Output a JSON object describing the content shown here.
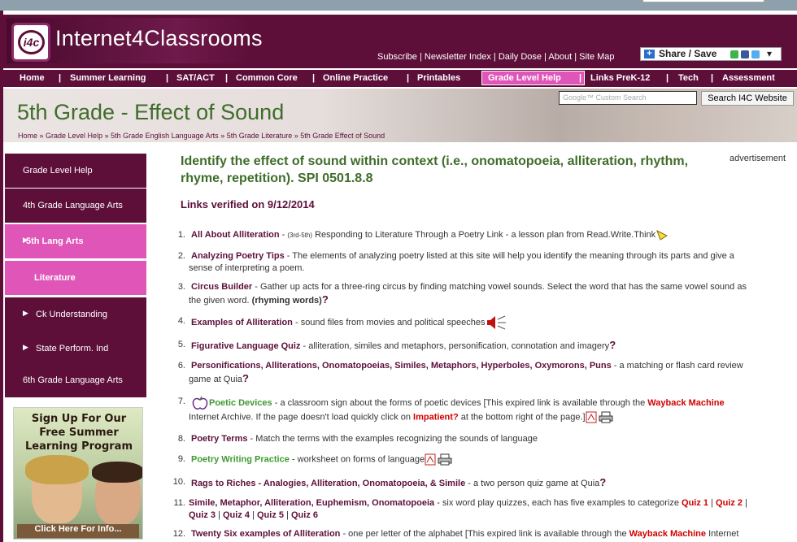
{
  "site": {
    "logo_mark": "i4c",
    "logo_text": "Internet4Classrooms"
  },
  "toplinks": [
    "Subscribe",
    "Newsletter Index",
    "Daily Dose",
    "About",
    "Site Map"
  ],
  "share_label": "Share / Save",
  "nav": {
    "items": [
      "Home",
      "Summer Learning",
      "SAT/ACT",
      "Common Core",
      "Online Practice",
      "Printables",
      "Grade Level Help",
      "Links PreK-12",
      "Tech",
      "Assessment"
    ],
    "active": "Grade Level Help"
  },
  "banner": {
    "title_grade": "5th Grade",
    "title_sep": " - ",
    "title_topic": "Effect of Sound",
    "search_placeholder": "Google™ Custom Search",
    "search_button": "Search I4C Website",
    "breadcrumb": [
      "Home",
      "Grade Level Help",
      "5th Grade English Language Arts",
      "5th Grade Literature",
      "5th Grade Effect of Sound"
    ]
  },
  "sidebar": {
    "items": [
      {
        "label": "Grade Level Help",
        "style": "dark"
      },
      {
        "label": "4th Grade Language Arts",
        "style": "dark"
      },
      {
        "label": "5th Lang Arts",
        "style": "pink"
      },
      {
        "label": "Literature",
        "style": "pink"
      },
      {
        "label": "Ck Understanding",
        "style": "dark"
      },
      {
        "label": "State Perform. Ind",
        "style": "dark"
      },
      {
        "label": "6th Grade Language Arts",
        "style": "dark"
      }
    ],
    "promo": {
      "line1": "Sign Up For Our",
      "line2": "Free Summer",
      "line3": "Learning Program",
      "cta": "Click Here For Info..."
    }
  },
  "main": {
    "heading": "Identify the effect of sound within context (i.e., onomatopoeia, alliteration, rhythm, rhyme, repetition). SPI 0501.8.8",
    "advertisement": "advertisement",
    "verified": "Links verified on 9/12/2014",
    "items": [
      {
        "n": "1.",
        "link": "All About Alliteration",
        "pre": "(3rd-5th)",
        "desc": "Responding to Literature Through a Poetry Link - a lesson plan from Read.Write.Think"
      },
      {
        "n": "2.",
        "link": "Analyzing Poetry Tips",
        "desc": "The elements of analyzing poetry listed at this site will help you identify the meaning through its parts and give a",
        "desc2": "sense of interpreting a poem."
      },
      {
        "n": "3.",
        "link": "Circus Builder",
        "desc": "Gather up acts for a three-ring circus by finding matching vowel sounds. Select the word that has the same vowel sound as",
        "desc2": "the given word.",
        "desc2b": "(rhyming words)"
      },
      {
        "n": "4.",
        "link": "Examples of Alliteration",
        "desc": "sound files from movies and political speeches"
      },
      {
        "n": "5.",
        "link": "Figurative Language Quiz",
        "desc": "alliteration, similes and metaphors, personification, connotation and imagery"
      },
      {
        "n": "6.",
        "link": "Personifications, Alliterations, Onomatopoeias, Similes, Metaphors, Hyperboles, Oxymorons, Puns",
        "desc": "a matching or flash card review",
        "desc2": "game at Quia"
      },
      {
        "n": "7.",
        "link": "Poetic Devices",
        "desc": "a classroom sign about the forms of poetic devices [This expired link is available through the",
        "red1": "Wayback Machine",
        "desc2": "Internet Archive. If the page doesn't load quickly click on",
        "red2": "Impatient?",
        "desc2b": "at the bottom right of the page.]"
      },
      {
        "n": "8.",
        "link": "Poetry Terms",
        "desc": "Match the terms with the examples recognizing the sounds of language"
      },
      {
        "n": "9.",
        "link": "Poetry Writing Practice",
        "desc": "worksheet on forms of language"
      },
      {
        "n": "10.",
        "link": "Rags to Riches - Analogies, Alliteration, Onomatopoeia, & Simile",
        "desc": "a two person quiz game at Quia"
      },
      {
        "n": "11.",
        "link": "Simile, Metaphor, Alliteration, Euphemism, Onomatopoeia",
        "desc": "six word play quizzes, each has five examples to categorize",
        "quizzes": [
          "Quiz 1",
          "Quiz 2",
          "Quiz 3",
          "Quiz 4",
          "Quiz 5",
          "Quiz 6"
        ]
      },
      {
        "n": "12.",
        "link": "Twenty Six examples of Alliteration",
        "desc": "one per letter of the alphabet [This expired link is available through the",
        "red1": "Wayback Machine",
        "desc_end": "Internet"
      }
    ]
  },
  "colors": {
    "brand": "#5d0f3a",
    "accent_pink": "#e055b8",
    "heading_green": "#3e6d2a",
    "link_green": "#3e9a30",
    "wayback_red": "#d00000"
  }
}
